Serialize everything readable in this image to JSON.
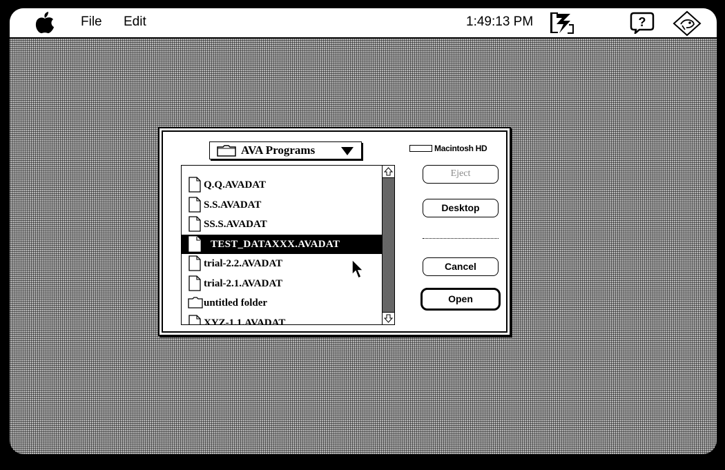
{
  "menubar": {
    "apple_icon": "apple-icon",
    "items": [
      {
        "label": "File"
      },
      {
        "label": "Edit"
      }
    ],
    "clock": "1:49:13 PM",
    "app_icon": "application-menu-icon",
    "help_icon": "help-balloon-icon",
    "finder_icon": "finder-icon"
  },
  "dialog": {
    "folder_popup": "AVA Programs",
    "disk_name": "Macintosh HD",
    "files": [
      {
        "name": "Q.Q.AVADAT",
        "kind": "document",
        "selected": false
      },
      {
        "name": "S.S.AVADAT",
        "kind": "document",
        "selected": false
      },
      {
        "name": "SS.S.AVADAT",
        "kind": "document",
        "selected": false
      },
      {
        "name": "TEST_DATAXXX.AVADAT",
        "kind": "document",
        "selected": true
      },
      {
        "name": "trial-2.2.AVADAT",
        "kind": "document",
        "selected": false
      },
      {
        "name": "trial-2.1.AVADAT",
        "kind": "document",
        "selected": false
      },
      {
        "name": "untitled folder",
        "kind": "folder",
        "selected": false
      },
      {
        "name": "XYZ-1.1.AVADAT",
        "kind": "document",
        "selected": false
      }
    ],
    "buttons": {
      "eject": "Eject",
      "desktop": "Desktop",
      "cancel": "Cancel",
      "open": "Open"
    }
  },
  "colors": {
    "desktop": "#8c8c8c",
    "selection": "#000000",
    "disabled_text": "#8a8a8a"
  }
}
